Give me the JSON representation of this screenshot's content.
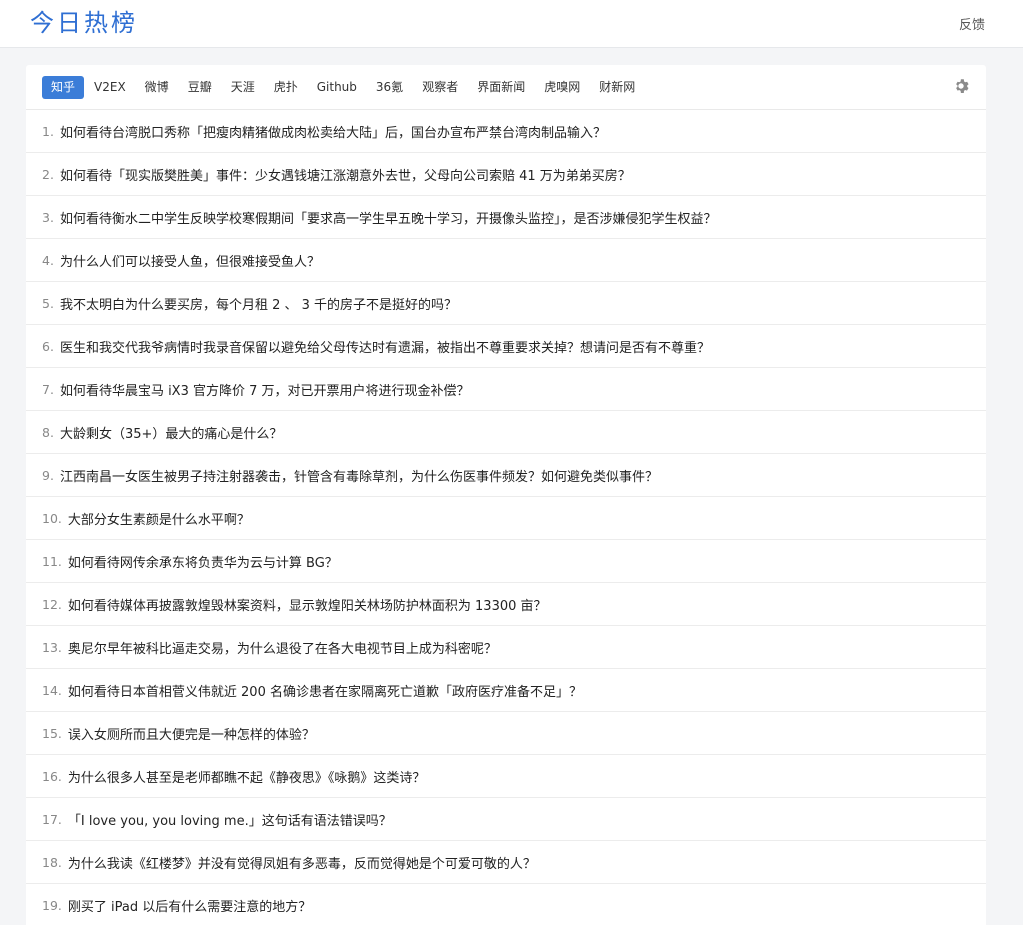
{
  "header": {
    "logo": "今日热榜",
    "feedback": "反馈"
  },
  "tabs": [
    {
      "label": "知乎",
      "active": true
    },
    {
      "label": "V2EX"
    },
    {
      "label": "微博"
    },
    {
      "label": "豆瓣"
    },
    {
      "label": "天涯"
    },
    {
      "label": "虎扑"
    },
    {
      "label": "Github"
    },
    {
      "label": "36氪"
    },
    {
      "label": "观察者"
    },
    {
      "label": "界面新闻"
    },
    {
      "label": "虎嗅网"
    },
    {
      "label": "财新网"
    }
  ],
  "settings_icon": "gear-icon",
  "items": [
    {
      "num": "1.",
      "title": "如何看待台湾脱口秀称「把瘦肉精猪做成肉松卖给大陆」后，国台办宣布严禁台湾肉制品输入？"
    },
    {
      "num": "2.",
      "title": "如何看待「现实版樊胜美」事件：少女遇钱塘江涨潮意外去世，父母向公司索赔 41 万为弟弟买房？"
    },
    {
      "num": "3.",
      "title": "如何看待衡水二中学生反映学校寒假期间「要求高一学生早五晚十学习，开摄像头监控」，是否涉嫌侵犯学生权益？"
    },
    {
      "num": "4.",
      "title": "为什么人们可以接受人鱼，但很难接受鱼人？"
    },
    {
      "num": "5.",
      "title": "我不太明白为什么要买房，每个月租 2 、 3 千的房子不是挺好的吗？"
    },
    {
      "num": "6.",
      "title": "医生和我交代我爷病情时我录音保留以避免给父母传达时有遗漏，被指出不尊重要求关掉？想请问是否有不尊重？"
    },
    {
      "num": "7.",
      "title": "如何看待华晨宝马 iX3 官方降价 7 万，对已开票用户将进行现金补偿？"
    },
    {
      "num": "8.",
      "title": "大龄剩女（35+）最大的痛心是什么？"
    },
    {
      "num": "9.",
      "title": "江西南昌一女医生被男子持注射器袭击，针管含有毒除草剂，为什么伤医事件频发？如何避免类似事件？"
    },
    {
      "num": "10.",
      "title": "大部分女生素颜是什么水平啊？"
    },
    {
      "num": "11.",
      "title": "如何看待网传余承东将负责华为云与计算 BG？"
    },
    {
      "num": "12.",
      "title": "如何看待媒体再披露敦煌毁林案资料，显示敦煌阳关林场防护林面积为 13300 亩？"
    },
    {
      "num": "13.",
      "title": "奥尼尔早年被科比逼走交易，为什么退役了在各大电视节目上成为科密呢？"
    },
    {
      "num": "14.",
      "title": "如何看待日本首相菅义伟就近 200 名确诊患者在家隔离死亡道歉「政府医疗准备不足」？"
    },
    {
      "num": "15.",
      "title": "误入女厕所而且大便完是一种怎样的体验？"
    },
    {
      "num": "16.",
      "title": "为什么很多人甚至是老师都瞧不起《静夜思》《咏鹅》这类诗？"
    },
    {
      "num": "17.",
      "title": "「I love you, you loving me.」这句话有语法错误吗？"
    },
    {
      "num": "18.",
      "title": "为什么我读《红楼梦》并没有觉得凤姐有多恶毒，反而觉得她是个可爱可敬的人？"
    },
    {
      "num": "19.",
      "title": "刚买了 iPad 以后有什么需要注意的地方？"
    }
  ]
}
